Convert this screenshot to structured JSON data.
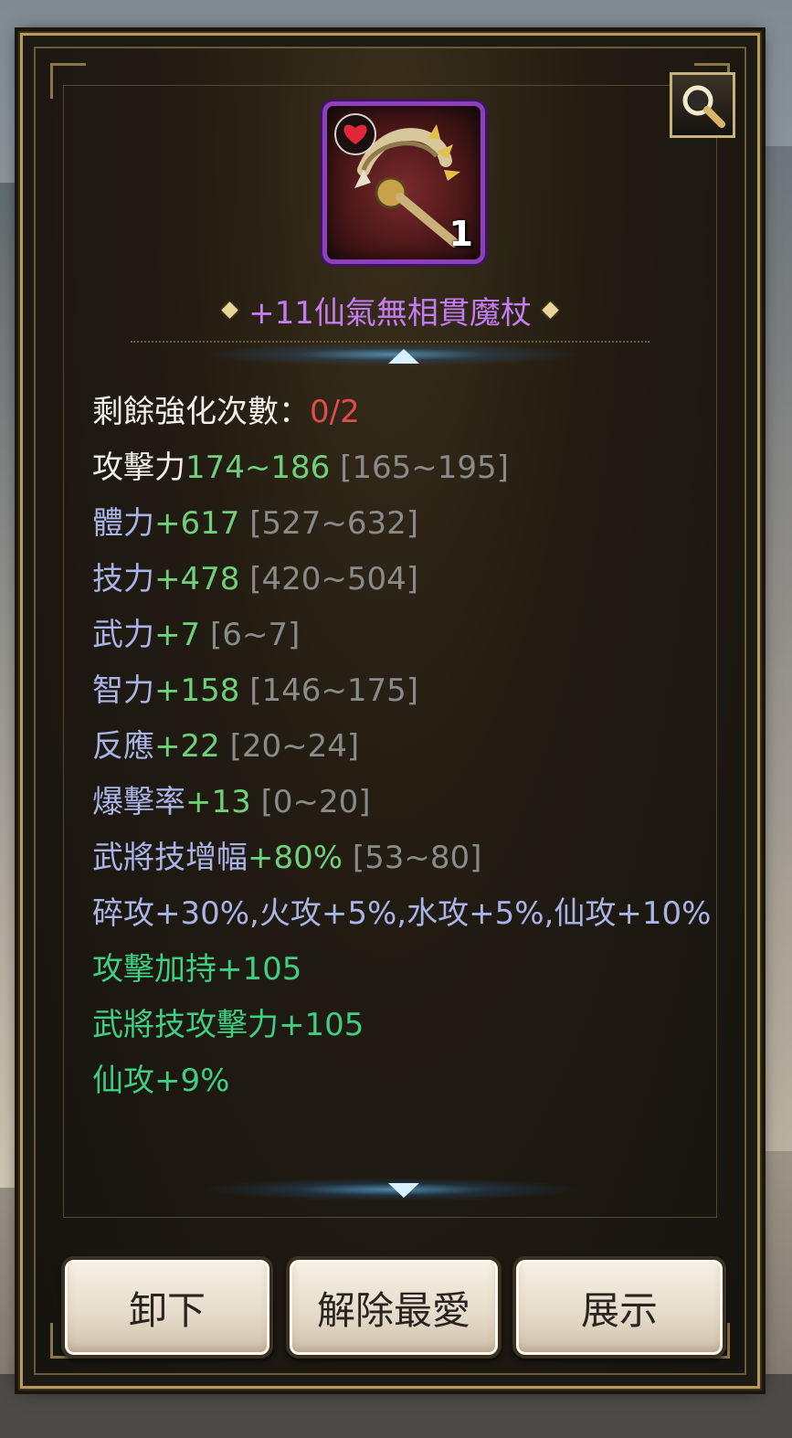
{
  "item": {
    "name": "+11仙氣無相貫魔杖",
    "count": "1",
    "favorite_icon": "heart-icon"
  },
  "stats": {
    "enhance_label": "剩餘強化次數：",
    "enhance_value": "0/2",
    "attack": {
      "label": "攻擊力",
      "value": "174~186",
      "range": "[165~195]"
    },
    "lines": [
      {
        "label": "體力",
        "value": "+617",
        "range": "[527~632]"
      },
      {
        "label": "技力",
        "value": "+478",
        "range": "[420~504]"
      },
      {
        "label": "武力",
        "value": "+7",
        "range": "[6~7]"
      },
      {
        "label": "智力",
        "value": "+158",
        "range": "[146~175]"
      },
      {
        "label": "反應",
        "value": "+22",
        "range": "[20~24]"
      },
      {
        "label": "爆擊率",
        "value": "+13",
        "range": "[0~20]"
      },
      {
        "label": "武將技增幅",
        "value": "+80%",
        "range": "[53~80]"
      }
    ],
    "elements": "碎攻+30%,火攻+5%,水攻+5%,仙攻+10%",
    "bonuses": [
      "攻擊加持+105",
      "武將技攻擊力+105",
      "仙攻+9%"
    ]
  },
  "buttons": {
    "unequip": "卸下",
    "unfavorite": "解除最愛",
    "show": "展示"
  },
  "icons": {
    "zoom": "magnifier-icon",
    "scroll_up": "arrow-up-icon",
    "scroll_down": "arrow-down-icon"
  }
}
